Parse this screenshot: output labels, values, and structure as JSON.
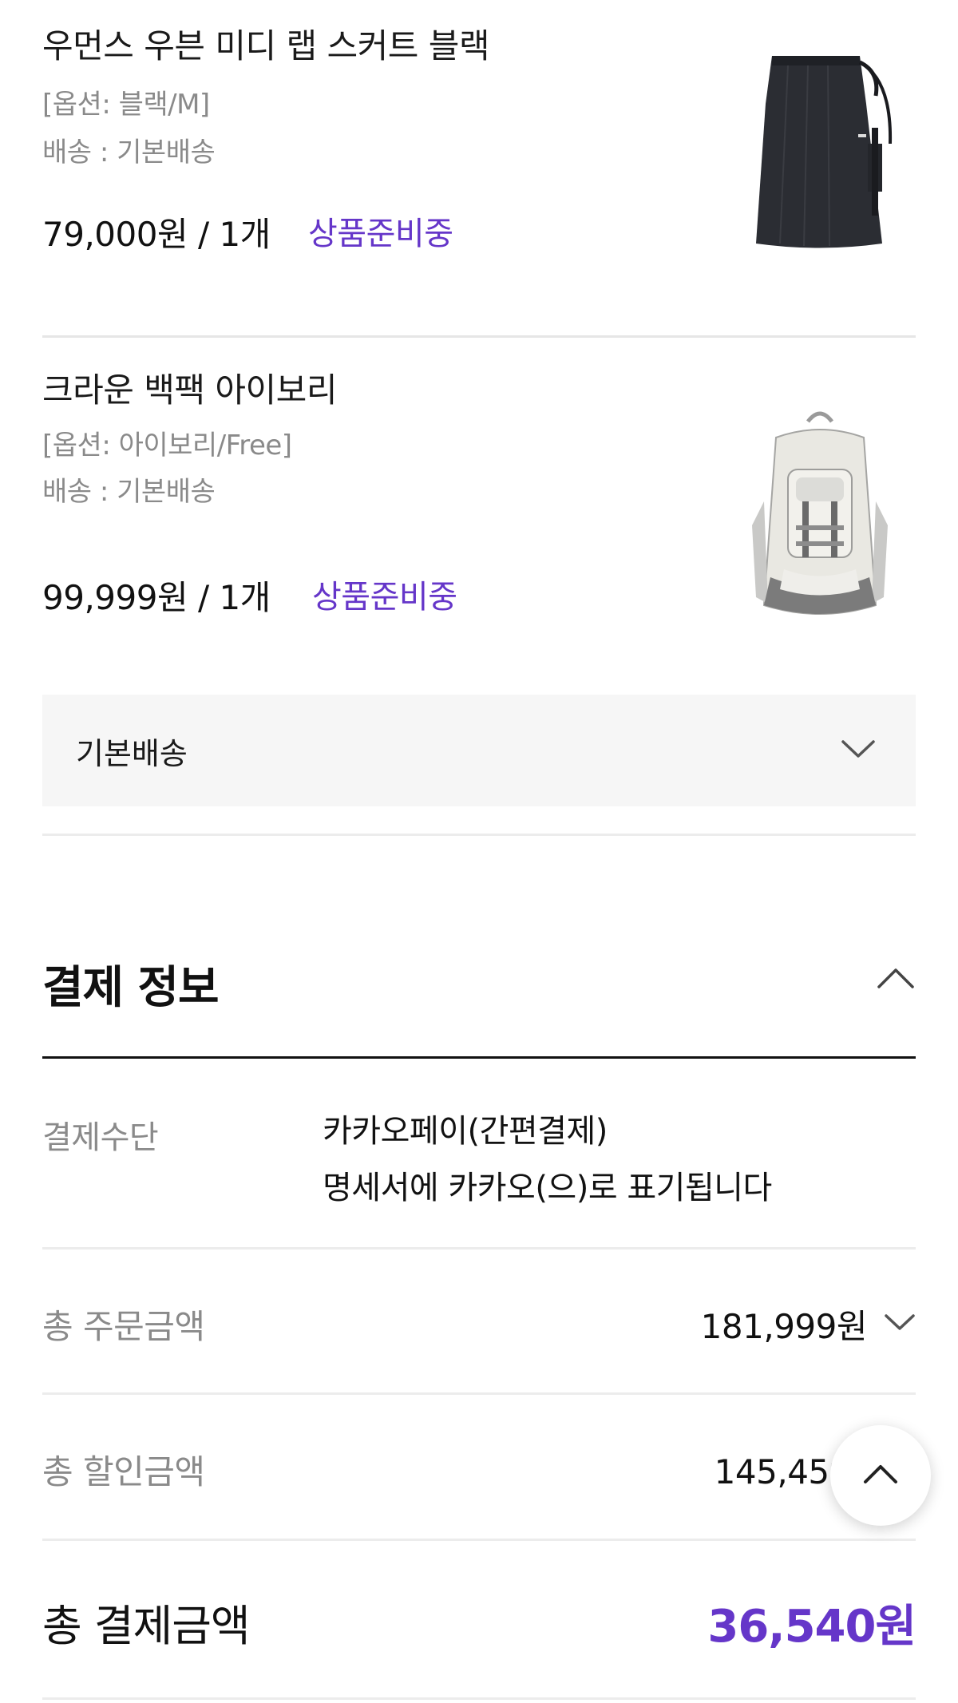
{
  "order_items": [
    {
      "name": "우먼스 우븐 미디 랩 스커트 블랙",
      "option": "[옵션: 블랙/M]",
      "shipping": "배송 : 기본배송",
      "price_qty": "79,000원 / 1개",
      "status": "상품준비중",
      "image": "skirt-image"
    },
    {
      "name": "크라운 백팩 아이보리",
      "option": "[옵션: 아이보리/Free]",
      "shipping": "배송 : 기본배송",
      "price_qty": "99,999원 / 1개",
      "status": "상품준비중",
      "image": "backpack-image"
    }
  ],
  "shipping_select": {
    "label": "기본배송",
    "icon": "chevron-down-icon"
  },
  "payment": {
    "title": "결제 정보",
    "toggle_icon": "chevron-up-icon",
    "method_label": "결제수단",
    "method_value_1": "카카오페이(간편결제)",
    "method_value_2": "명세서에 카카오(으)로 표기됩니다",
    "total_order_label": "총 주문금액",
    "total_order_value": "181,999원",
    "total_discount_label": "총 할인금액",
    "total_discount_value": "145,459원",
    "total_pay_label": "총 결제금액",
    "total_pay_value": "36,540원"
  },
  "scroll_top_icon": "chevron-up-icon",
  "colors": {
    "accent": "#6536c9",
    "divider": "#ececec",
    "select_bg": "#f6f6f6"
  }
}
